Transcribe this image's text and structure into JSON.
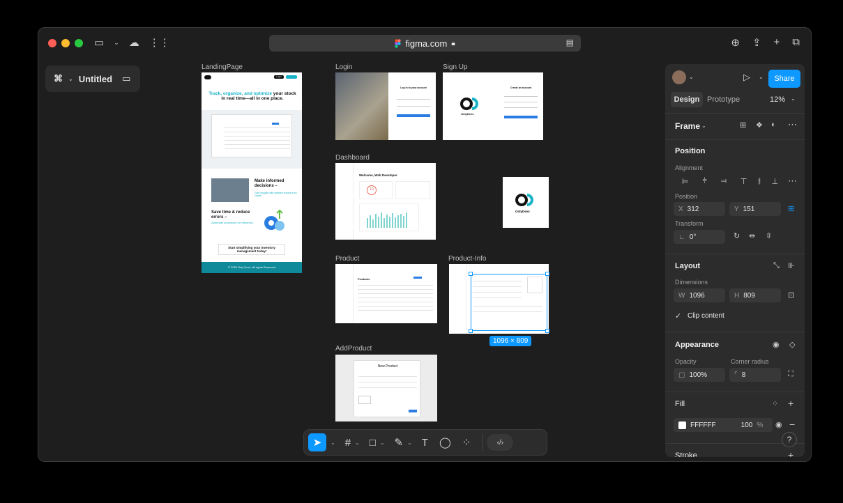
{
  "browser": {
    "url": "figma.com",
    "traffic_colors": [
      "#ff5f57",
      "#febc2e",
      "#28c840"
    ]
  },
  "file": {
    "name": "Untitled"
  },
  "frames": {
    "landing": {
      "label": "LandingPage",
      "headline_accent": "Track, organize, and optimize",
      "headline_rest": "your stock in real time—all in one place.",
      "section1_title": "Make informed decisions –",
      "section1_sub": "Gain insights with detailed reports from charts.",
      "section2_title": "Save time & reduce errors –",
      "section2_sub": "Automate processes for efficiency",
      "cta": "Start simplifying your inventory management today!",
      "footer": "© 2025 Only Devs. All rights Reserved",
      "nav_login": "Login",
      "accent_color": "#1ab3c6"
    },
    "login": {
      "label": "Login",
      "heading": "Log in to your account"
    },
    "signup": {
      "label": "Sign Up",
      "brand": "OnlyDevs",
      "heading": "Create an account"
    },
    "dashboard": {
      "label": "Dashboard",
      "welcome": "Welcome, Web Developer",
      "stat": "10"
    },
    "logo": {
      "brand": "OnlyDevs"
    },
    "product": {
      "label": "Product",
      "title": "Products"
    },
    "product_info": {
      "label": "Product-Info",
      "size": "1096 × 809"
    },
    "add_product": {
      "label": "AddProduct",
      "title": "New Product"
    }
  },
  "panel": {
    "share": "Share",
    "tab_design": "Design",
    "tab_prototype": "Prototype",
    "zoom": "12%",
    "frame_type": "Frame",
    "position": {
      "title": "Position",
      "alignment_label": "Alignment",
      "position_label": "Position",
      "x_label": "X",
      "x": "312",
      "y_label": "Y",
      "y": "151",
      "transform_label": "Transform",
      "rotation": "0°"
    },
    "layout": {
      "title": "Layout",
      "dimensions_label": "Dimensions",
      "w_label": "W",
      "w": "1096",
      "h_label": "H",
      "h": "809",
      "clip": "Clip content"
    },
    "appearance": {
      "title": "Appearance",
      "opacity_label": "Opacity",
      "opacity": "100%",
      "radius_label": "Corner radius",
      "radius": "8"
    },
    "fill": {
      "title": "Fill",
      "hex": "FFFFFF",
      "opacity": "100",
      "unit": "%"
    },
    "stroke": {
      "title": "Stroke"
    }
  },
  "colors": {
    "accent": "#0d99ff",
    "canvas": "#1e1e1e",
    "panel": "#2c2c2c"
  }
}
